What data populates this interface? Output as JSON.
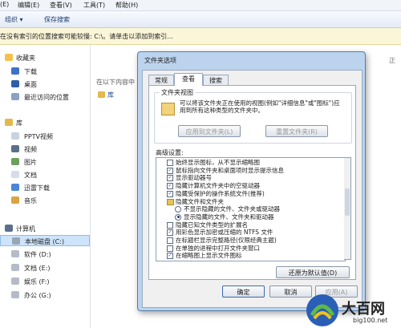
{
  "menu": [
    "(E)",
    "编辑(E)",
    "查看(V)",
    "工具(T)",
    "帮助(H)"
  ],
  "toolbar": {
    "organize": "组织 ▾",
    "save_search": "保存搜索"
  },
  "infobar": {
    "text": "在没有索引的位置搜索可能较慢: C:\\。请单击以添加到索引..."
  },
  "nav": {
    "favorites": "收藏夹",
    "fav_items": [
      "下载",
      "桌面",
      "最近访问的位置"
    ],
    "libraries": "库",
    "lib_items": [
      "PPTV视频",
      "视频",
      "图片",
      "文档",
      "迅雷下载",
      "音乐"
    ],
    "computer": "计算机",
    "drives": [
      "本地磁盘 (C:)",
      "软件 (D:)",
      "文档 (E:)",
      "娱乐 (F:)",
      "办公 (G:)"
    ]
  },
  "content": {
    "search_hint": "在以下内容中",
    "lib_link": "库",
    "right_fragment": "正"
  },
  "dialog": {
    "title": "文件夹选项",
    "tabs": [
      "常规",
      "查看",
      "搜索"
    ],
    "views_group": "文件夹视图",
    "views_desc": "可以将该文件夹正在使用的视图(例如\"详细信息\"或\"图标\")应用到所有这种类型的文件夹中。",
    "apply_btn": "应用到文件夹(L)",
    "reset_btn": "重置文件夹(R)",
    "advanced_label": "高级设置:",
    "advanced_items": [
      {
        "kind": "check",
        "checked": false,
        "indent": 0,
        "text": "始终显示图标，从不显示缩略图"
      },
      {
        "kind": "check",
        "checked": true,
        "indent": 0,
        "text": "鼠标指向文件夹和桌面项时显示提示信息"
      },
      {
        "kind": "check",
        "checked": true,
        "indent": 0,
        "text": "显示驱动器号"
      },
      {
        "kind": "check",
        "checked": true,
        "indent": 0,
        "text": "隐藏计算机文件夹中的空驱动器"
      },
      {
        "kind": "check",
        "checked": true,
        "indent": 0,
        "text": "隐藏受保护的操作系统文件(推荐)"
      },
      {
        "kind": "folder",
        "checked": false,
        "indent": 0,
        "text": "隐藏文件和文件夹"
      },
      {
        "kind": "radio",
        "checked": false,
        "indent": 1,
        "text": "不显示隐藏的文件、文件夹或驱动器"
      },
      {
        "kind": "radio",
        "checked": true,
        "indent": 1,
        "text": "显示隐藏的文件、文件夹和驱动器"
      },
      {
        "kind": "check",
        "checked": false,
        "indent": 0,
        "text": "隐藏已知文件类型的扩展名"
      },
      {
        "kind": "check",
        "checked": true,
        "indent": 0,
        "text": "用彩色显示加密或压缩的 NTFS 文件"
      },
      {
        "kind": "check",
        "checked": false,
        "indent": 0,
        "text": "在标题栏显示完整路径(仅限经典主题)"
      },
      {
        "kind": "check",
        "checked": false,
        "indent": 0,
        "text": "在单独的进程中打开文件夹窗口"
      },
      {
        "kind": "check",
        "checked": true,
        "indent": 0,
        "text": "在缩略图上显示文件图标"
      }
    ],
    "restore_btn": "还原为默认值(D)",
    "ok_btn": "确定",
    "cancel_btn": "取消",
    "apply_disabled": "应用(A)"
  },
  "watermark": {
    "main": "大百网",
    "sub": "big100.net"
  },
  "colors": {
    "accent": "#1d3f8c",
    "selection": "#cde4fb",
    "dialog_frame": "#bcd3ee"
  }
}
